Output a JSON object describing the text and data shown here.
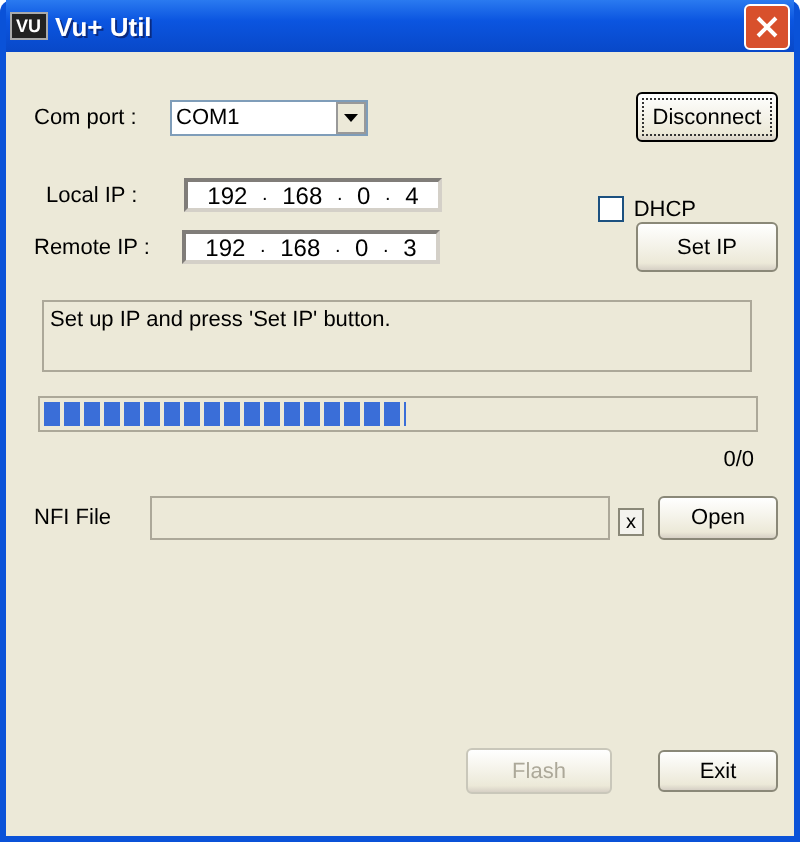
{
  "window": {
    "logo": "VU",
    "title": "Vu+ Util"
  },
  "com_port": {
    "label": "Com port :",
    "value": "COM1"
  },
  "disconnect_button": {
    "label": "Disconnect",
    "focused": true
  },
  "local_ip": {
    "label": "Local IP :",
    "octets": [
      "192",
      "168",
      "0",
      "4"
    ],
    "separator": "."
  },
  "remote_ip": {
    "label": "Remote IP :",
    "octets": [
      "192",
      "168",
      "0",
      "3"
    ],
    "separator": "."
  },
  "dhcp": {
    "label": "DHCP",
    "checked": false
  },
  "set_ip_button": {
    "label": "Set IP"
  },
  "status_message": "Set up IP and press 'Set IP' button.",
  "progress": {
    "level": 0.51,
    "reading": "0/0"
  },
  "nfi_file": {
    "label": "NFI File",
    "clear": "x",
    "open": "Open"
  },
  "buttons": [
    {
      "label": "Flash",
      "disabled": true
    },
    {
      "label": "Exit",
      "disabled": false
    }
  ]
}
